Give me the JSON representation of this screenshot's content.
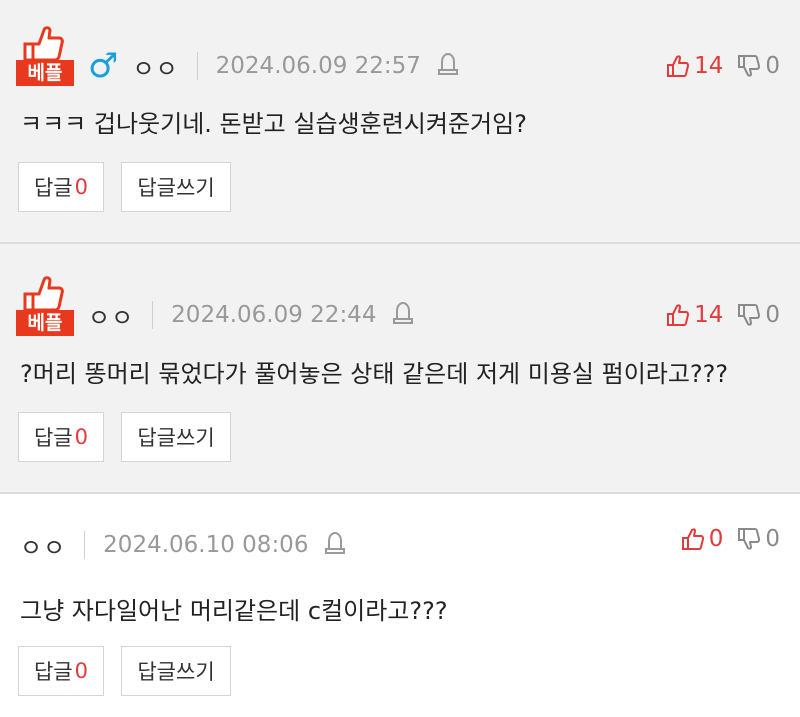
{
  "comments": [
    {
      "best_badge": "베플",
      "gender_icon": "male-icon",
      "nickname": "ㅇㅇ",
      "date": "2024.06.09 22:57",
      "upvotes": "14",
      "downvotes": "0",
      "text": "ㅋㅋㅋ 겁나웃기네. 돈받고 실습생훈련시켜준거임?",
      "reply_label": "답글",
      "reply_count": "0",
      "write_reply_label": "답글쓰기"
    },
    {
      "best_badge": "베플",
      "nickname": "ㅇㅇ",
      "date": "2024.06.09 22:44",
      "upvotes": "14",
      "downvotes": "0",
      "text": "?머리 똥머리 묶었다가 풀어놓은 상태 같은데 저게 미용실 펌이라고???",
      "reply_label": "답글",
      "reply_count": "0",
      "write_reply_label": "답글쓰기"
    },
    {
      "nickname": "ㅇㅇ",
      "date": "2024.06.10 08:06",
      "upvotes": "0",
      "downvotes": "0",
      "text": "그냥 자다일어난 머리같은데 c컬이라고???",
      "reply_label": "답글",
      "reply_count": "0",
      "write_reply_label": "답글쓰기"
    }
  ],
  "colors": {
    "best_background": "#f2f2f2",
    "badge_red": "#e8391e",
    "upvote_red": "#e23b3b",
    "male_blue": "#1aa0d8",
    "muted_gray": "#999999"
  }
}
